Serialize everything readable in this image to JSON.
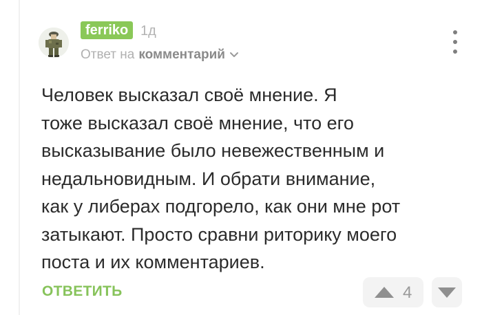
{
  "comment": {
    "author": "ferriko",
    "time_ago": "1д",
    "reply_to_prefix": "Ответ на",
    "reply_to_target": "комментарий",
    "text": "Человек высказал своё мнение. Я\nтоже высказал своё мнение, что его\nвысказывание было невежественным и\nнедальновидным. И обрати внимание,\nкак у либерах подгорело, как они мне рот\nзатыкают. Просто сравни риторику моего\nпоста и их комментариев.",
    "reply_label": "ОТВЕТИТЬ",
    "score": "4"
  },
  "icons": {
    "more": "more-vertical-icon",
    "chevron": "chevron-down-icon",
    "up": "upvote-triangle-icon",
    "down": "downvote-triangle-icon"
  },
  "colors": {
    "accent_green": "#8ac858",
    "text": "#2b2b2b",
    "muted": "#b0b0b0"
  }
}
